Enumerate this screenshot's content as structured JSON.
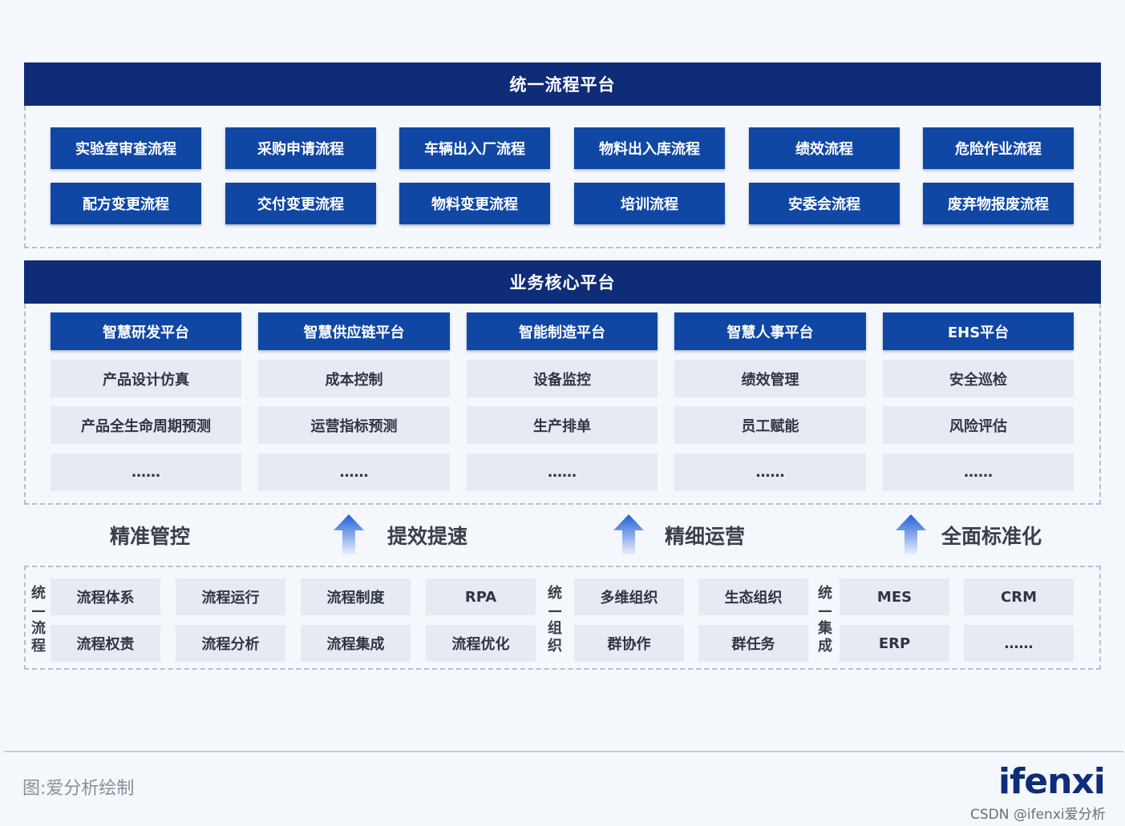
{
  "top_platform": {
    "title": "统一流程平台",
    "rows": [
      [
        "实验室审查流程",
        "采购申请流程",
        "车辆出入厂流程",
        "物料出入库流程",
        "绩效流程",
        "危险作业流程"
      ],
      [
        "配方变更流程",
        "交付变更流程",
        "物料变更流程",
        "培训流程",
        "安委会流程",
        "废弃物报废流程"
      ]
    ]
  },
  "core_platform": {
    "title": "业务核心平台",
    "columns": [
      {
        "header": "智慧研发平台",
        "items": [
          "产品设计仿真",
          "产品全生命周期预测",
          "……"
        ]
      },
      {
        "header": "智慧供应链平台",
        "items": [
          "成本控制",
          "运营指标预测",
          "……"
        ]
      },
      {
        "header": "智能制造平台",
        "items": [
          "设备监控",
          "生产排单",
          "……"
        ]
      },
      {
        "header": "智慧人事平台",
        "items": [
          "绩效管理",
          "员工赋能",
          "……"
        ]
      },
      {
        "header": "EHS平台",
        "items": [
          "安全巡检",
          "风险评估",
          "……"
        ]
      }
    ]
  },
  "slogans": [
    "精准管控",
    "提效提速",
    "精细运营",
    "全面标准化"
  ],
  "base": {
    "groups": [
      {
        "label": [
          "统",
          "—",
          "流",
          "程"
        ],
        "cells": [
          [
            "流程体系",
            "流程运行",
            "流程制度",
            "RPA"
          ],
          [
            "流程权责",
            "流程分析",
            "流程集成",
            "流程优化"
          ]
        ]
      },
      {
        "label": [
          "统",
          "—",
          "组",
          "织"
        ],
        "cells": [
          [
            "多维组织",
            "生态组织"
          ],
          [
            "群协作",
            "群任务"
          ]
        ]
      },
      {
        "label": [
          "统",
          "—",
          "集",
          "成"
        ],
        "cells": [
          [
            "MES",
            "CRM"
          ],
          [
            "ERP",
            "……"
          ]
        ]
      }
    ]
  },
  "footer": {
    "caption": "图:爱分析绘制",
    "logo": "ifenxi",
    "watermark": "CSDN @ifenxi爱分析"
  },
  "colors": {
    "banner": "#0f2c78",
    "dark_button": "#1047a4",
    "light_cell": "#e6eaf3",
    "arrow": "#2f6fe0"
  }
}
